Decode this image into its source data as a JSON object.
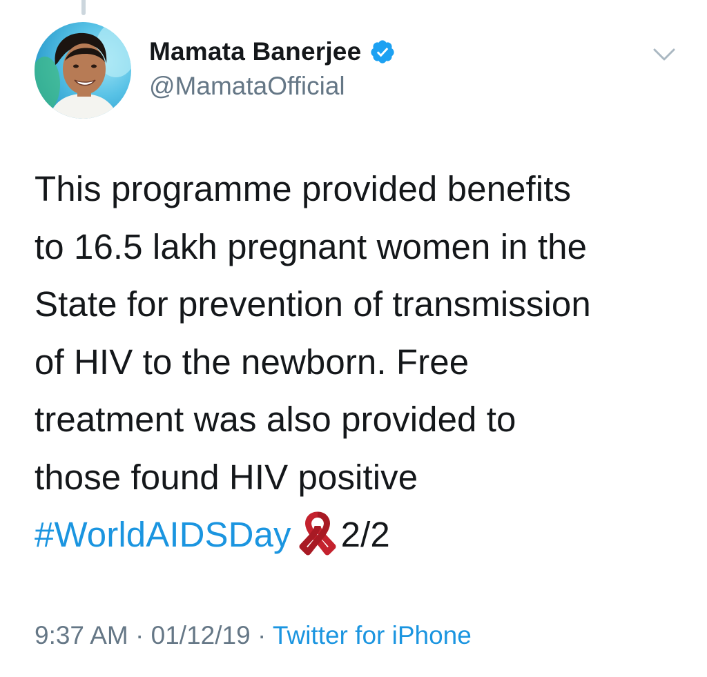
{
  "tweet": {
    "author": {
      "display_name": "Mamata Banerjee",
      "handle": "@MamataOfficial",
      "verified": true,
      "verified_color": "#1da1f2"
    },
    "text_lines": [
      "This programme provided benefits",
      "to 16.5 lakh pregnant women in the",
      "State for prevention of transmission",
      "of HIV to the newborn. Free",
      "treatment was also provided to",
      "those found HIV positive"
    ],
    "hashtag": "#WorldAIDSDay",
    "emoji": "red-ribbon-icon",
    "thread_count": "2/2",
    "time": "9:37 AM",
    "separator": "·",
    "date": "01/12/19",
    "source": "Twitter for iPhone"
  },
  "colors": {
    "text": "#14171a",
    "secondary": "#657786",
    "link": "#1b95e0",
    "ribbon": "#c4222e"
  }
}
